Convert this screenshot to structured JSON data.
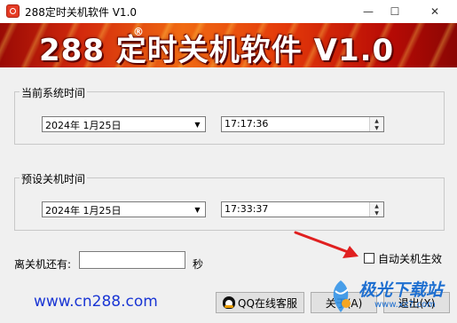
{
  "window": {
    "title": "288定时关机软件 V1.0",
    "controls": {
      "minimize": "—",
      "maximize": "☐",
      "close": "✕"
    }
  },
  "banner": {
    "title": "288 定时关机软件 V1.0",
    "registered_mark": "®"
  },
  "current_time_group": {
    "label": "当前系统时间",
    "date_value": "2024年  1月25日",
    "time_value": "17:17:36"
  },
  "preset_time_group": {
    "label": "预设关机时间",
    "date_value": "2024年  1月25日",
    "time_value": "17:33:37"
  },
  "remaining": {
    "label": "离关机还有:",
    "value": "",
    "unit": "秒"
  },
  "auto_shutdown": {
    "label": "自动关机生效",
    "checked": false
  },
  "footer": {
    "link": "www.cn288.com",
    "qq_button": "QQ在线客服",
    "about_button": "关于(A)",
    "exit_button": "退出(X)"
  },
  "watermark": {
    "text": "极光下载站",
    "sub": "www.xz7.com"
  },
  "colors": {
    "arrow": "#e02020",
    "link": "#1a36d4",
    "banner": "#e23a0d"
  }
}
